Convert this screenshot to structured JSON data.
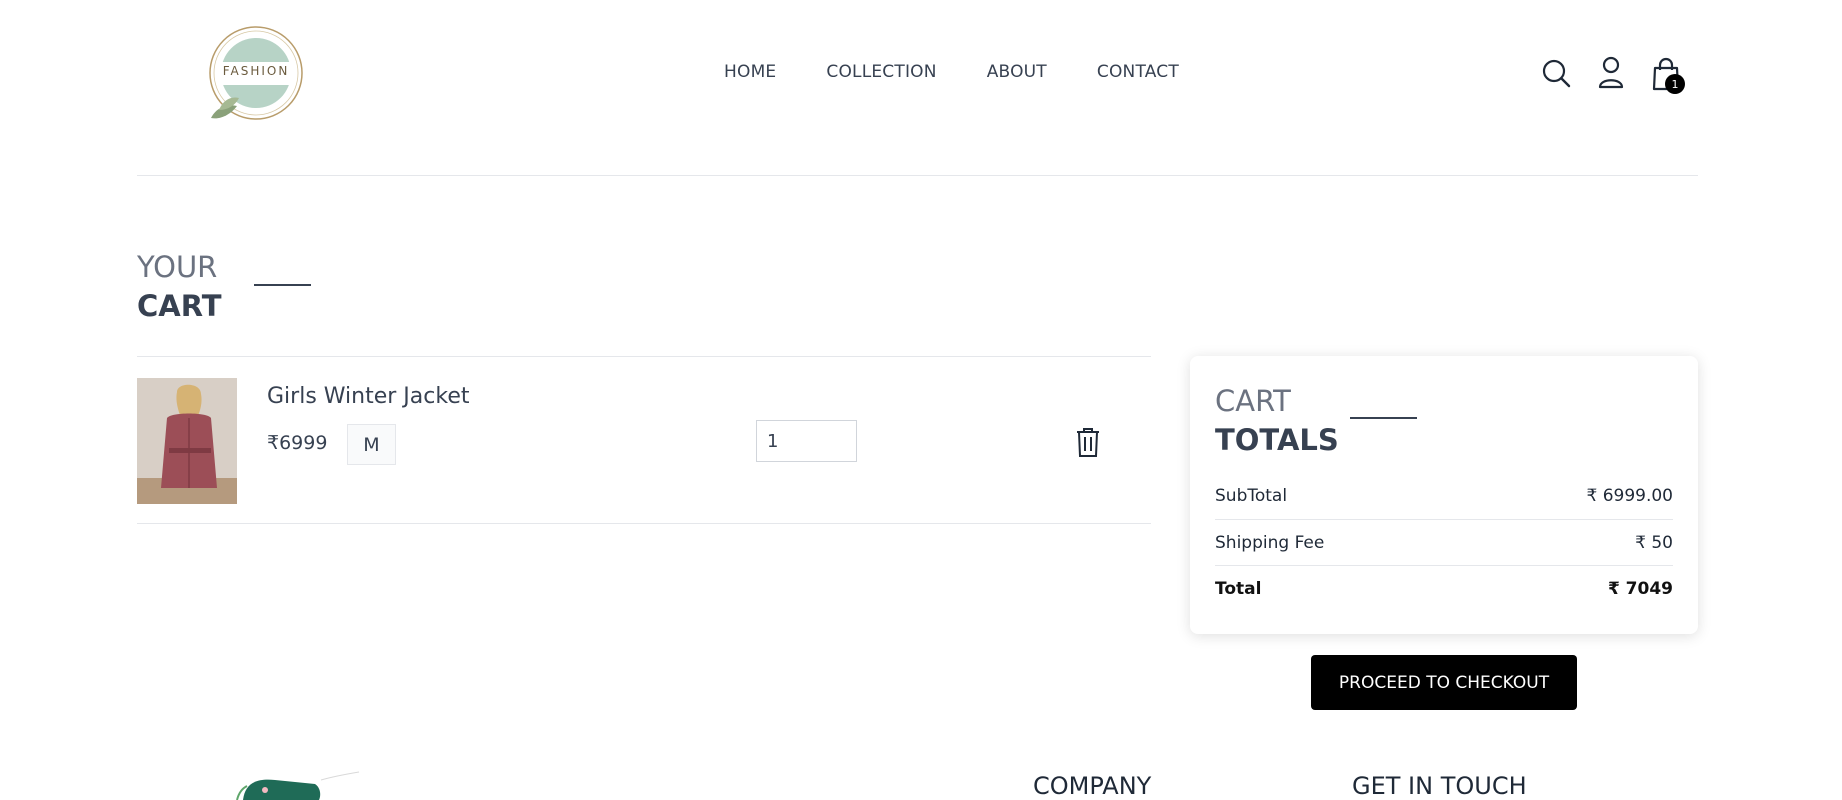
{
  "header": {
    "logo_text": "FASHION",
    "nav": [
      {
        "label": "HOME"
      },
      {
        "label": "COLLECTION"
      },
      {
        "label": "ABOUT"
      },
      {
        "label": "CONTACT"
      }
    ],
    "cart_count": "1"
  },
  "page_title": {
    "top": "YOUR",
    "bottom": "CART"
  },
  "cart_items": [
    {
      "name": "Girls Winter Jacket",
      "price": "₹6999",
      "size": "M",
      "quantity": "1"
    }
  ],
  "totals": {
    "title_top": "CART",
    "title_bottom": "TOTALS",
    "subtotal_label": "SubTotal",
    "subtotal_value": "₹ 6999.00",
    "shipping_label": "Shipping Fee",
    "shipping_value": "₹ 50",
    "total_label": "Total",
    "total_value": "₹ 7049"
  },
  "checkout_label": "PROCEED TO CHECKOUT",
  "footer": {
    "company_heading": "COMPANY",
    "contact_heading": "GET IN TOUCH"
  }
}
